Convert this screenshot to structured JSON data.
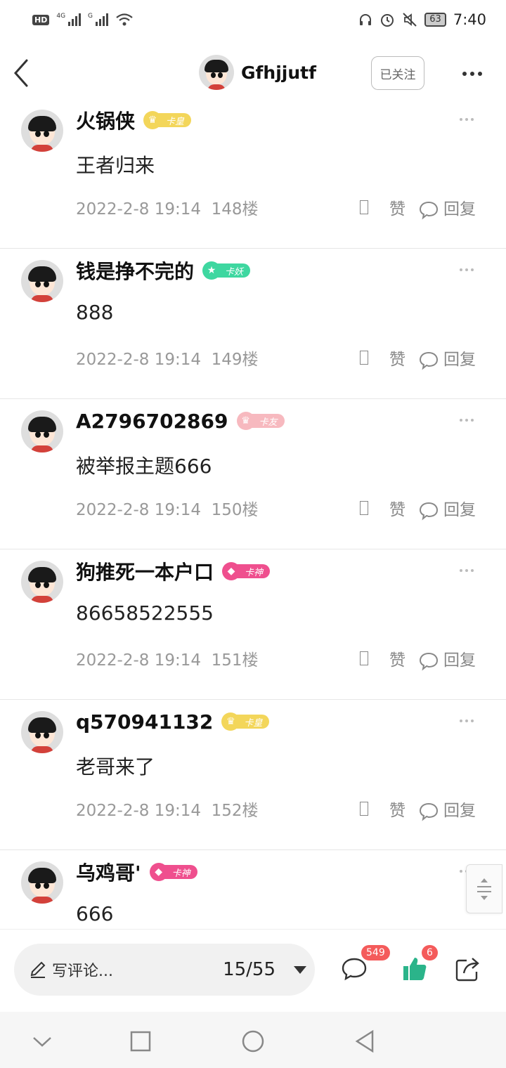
{
  "status_bar": {
    "hd": "HD",
    "net1": "4G",
    "net2": "G",
    "battery": "63",
    "time": "7:40"
  },
  "header": {
    "username": "Gfhjjutf",
    "follow_label": "已关注"
  },
  "comments": [
    {
      "name": "火锅侠",
      "badge": "卡皇",
      "badge_icon": "crown-icon",
      "badge_color": "#f3d65a",
      "body": "王者归来",
      "date": "2022-2-8 19:14",
      "floor": "148楼",
      "like": "赞",
      "reply": "回复"
    },
    {
      "name": "钱是挣不完的",
      "badge": "卡妖",
      "badge_icon": "star-icon",
      "badge_color": "#3ed7a0",
      "body": "888",
      "date": "2022-2-8 19:14",
      "floor": "149楼",
      "like": "赞",
      "reply": "回复"
    },
    {
      "name": "A2796702869",
      "badge": "卡友",
      "badge_icon": "crown-icon",
      "badge_color": "#f7b9bf",
      "body": "被举报主题666",
      "date": "2022-2-8 19:14",
      "floor": "150楼",
      "like": "赞",
      "reply": "回复"
    },
    {
      "name": "狗推死一本户口",
      "badge": "卡神",
      "badge_icon": "diamond-icon",
      "badge_color": "#ef4f8e",
      "body": "86658522555",
      "date": "2022-2-8 19:14",
      "floor": "151楼",
      "like": "赞",
      "reply": "回复"
    },
    {
      "name": "q570941132",
      "badge": "卡皇",
      "badge_icon": "crown-icon",
      "badge_color": "#f3d65a",
      "body": "老哥来了",
      "date": "2022-2-8 19:14",
      "floor": "152楼",
      "like": "赞",
      "reply": "回复"
    },
    {
      "name": "乌鸡哥'",
      "badge": "卡神",
      "badge_icon": "diamond-icon",
      "badge_color": "#ef4f8e",
      "body": "666",
      "date": "",
      "floor": "",
      "like": "",
      "reply": ""
    }
  ],
  "composer": {
    "placeholder": "写评论...",
    "page": "15/55"
  },
  "bottom_counts": {
    "comments": "549",
    "likes": "6"
  },
  "colors": {
    "like_green": "#2bb48a",
    "badge_red": "#f45b5b"
  }
}
